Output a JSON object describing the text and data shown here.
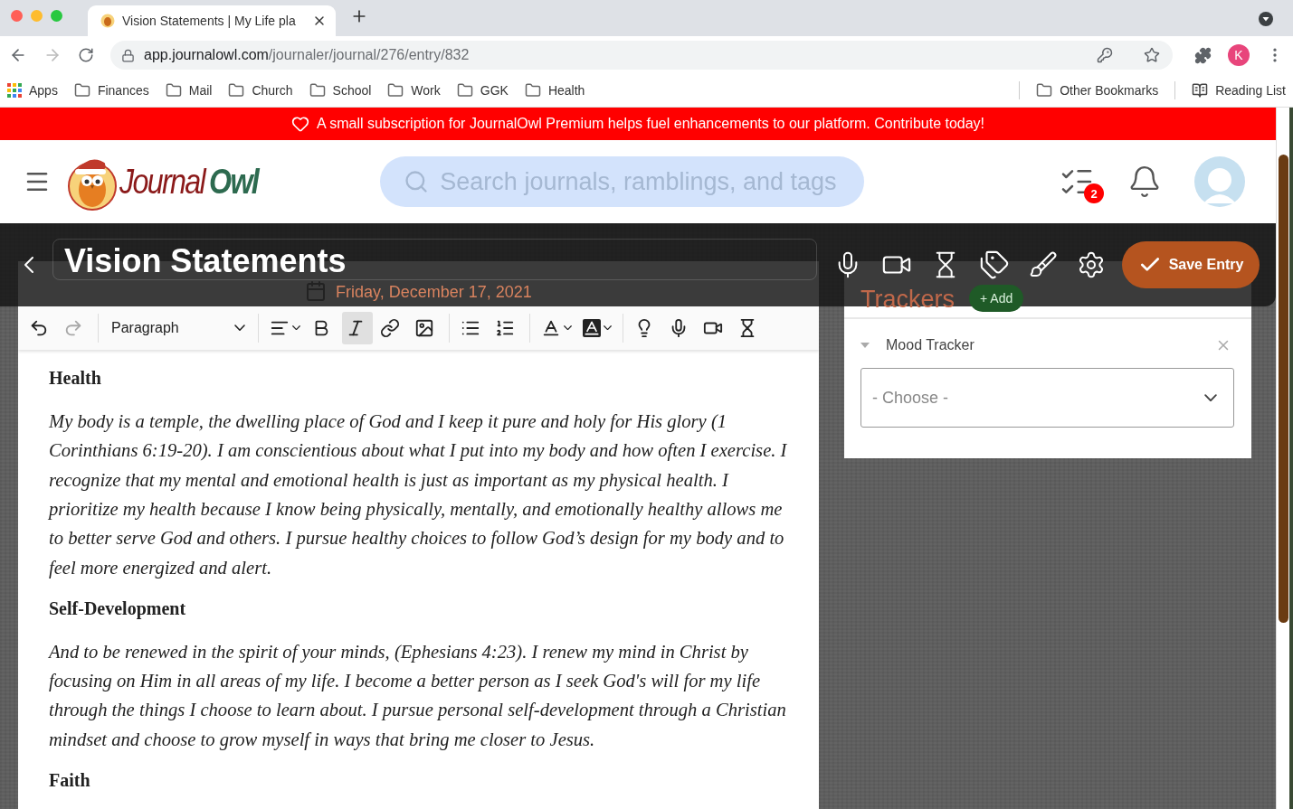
{
  "browser": {
    "tab_title": "Vision Statements | My Life pla",
    "url_host": "app.journalowl.com",
    "url_path": "/journaler/journal/276/entry/832",
    "profile_initial": "K",
    "forward_disabled": true,
    "bookmarks": [
      {
        "label": "Apps",
        "kind": "apps"
      },
      {
        "label": "Finances",
        "kind": "folder"
      },
      {
        "label": "Mail",
        "kind": "folder"
      },
      {
        "label": "Church",
        "kind": "folder"
      },
      {
        "label": "School",
        "kind": "folder"
      },
      {
        "label": "Work",
        "kind": "folder"
      },
      {
        "label": "GGK",
        "kind": "folder"
      },
      {
        "label": "Health",
        "kind": "folder"
      }
    ],
    "other_bookmarks": "Other Bookmarks",
    "reading_list": "Reading List"
  },
  "banner": {
    "text": "A small subscription for JournalOwl Premium helps fuel enhancements to our platform. Contribute today!"
  },
  "header": {
    "logo": {
      "first": "Journal",
      "second": "Owl"
    },
    "search": {
      "placeholder": "Search journals, ramblings, and tags"
    },
    "tasks_badge": "2"
  },
  "entry": {
    "title": "Vision Statements",
    "date": "Friday, December 17, 2021",
    "save_label": "Save Entry",
    "toolbar": [
      {
        "kind": "undo",
        "active": false,
        "disabled": false
      },
      {
        "kind": "redo",
        "active": false,
        "disabled": true
      },
      {
        "kind": "format",
        "label": "Paragraph",
        "active": false,
        "disabled": false
      },
      {
        "kind": "align",
        "active": false,
        "disabled": false
      },
      {
        "kind": "bold",
        "active": false,
        "disabled": false
      },
      {
        "kind": "italic",
        "active": true,
        "disabled": false
      },
      {
        "kind": "link",
        "active": false,
        "disabled": false
      },
      {
        "kind": "image",
        "active": false,
        "disabled": false
      },
      {
        "kind": "bullets",
        "active": false,
        "disabled": false
      },
      {
        "kind": "numbers",
        "active": false,
        "disabled": false
      },
      {
        "kind": "text-color",
        "active": false,
        "disabled": false
      },
      {
        "kind": "highlight",
        "active": false,
        "disabled": false
      },
      {
        "kind": "prompt",
        "active": false,
        "disabled": false
      },
      {
        "kind": "audio",
        "active": false,
        "disabled": false
      },
      {
        "kind": "video",
        "active": false,
        "disabled": false
      },
      {
        "kind": "timer",
        "active": false,
        "disabled": false
      }
    ],
    "blocks": [
      {
        "kind": "heading",
        "text": "Health"
      },
      {
        "kind": "paragraph",
        "text": "My body is a temple, the dwelling place of God and I keep it pure and holy for His glory (1 Corinthians 6:19-20). I am conscientious about what I put into my body and how often I exercise. I recognize that my mental and emotional health is just as important as my physical health. I prioritize my health because I know being physically, mentally, and emotionally healthy allows me to better serve God and others. I pursue healthy choices to follow God’s design for my body and to feel more energized and alert."
      },
      {
        "kind": "heading",
        "text": "Self-Development"
      },
      {
        "kind": "paragraph",
        "text": "And to be renewed in the spirit of your minds, (Ephesians 4:23). I renew my mind in Christ by focusing on Him in all areas of my life. I become a better person as I seek God's will for my life through the things I choose to learn about. I pursue personal self-development through a Christian mindset and choose to grow myself in ways that bring me closer to Jesus."
      },
      {
        "kind": "heading",
        "text": "Faith"
      }
    ]
  },
  "trackers": {
    "title": "Trackers",
    "add_label": "+ Add",
    "items": [
      {
        "name": "Mood Tracker",
        "placeholder": "- Choose -",
        "expanded": true
      }
    ]
  }
}
